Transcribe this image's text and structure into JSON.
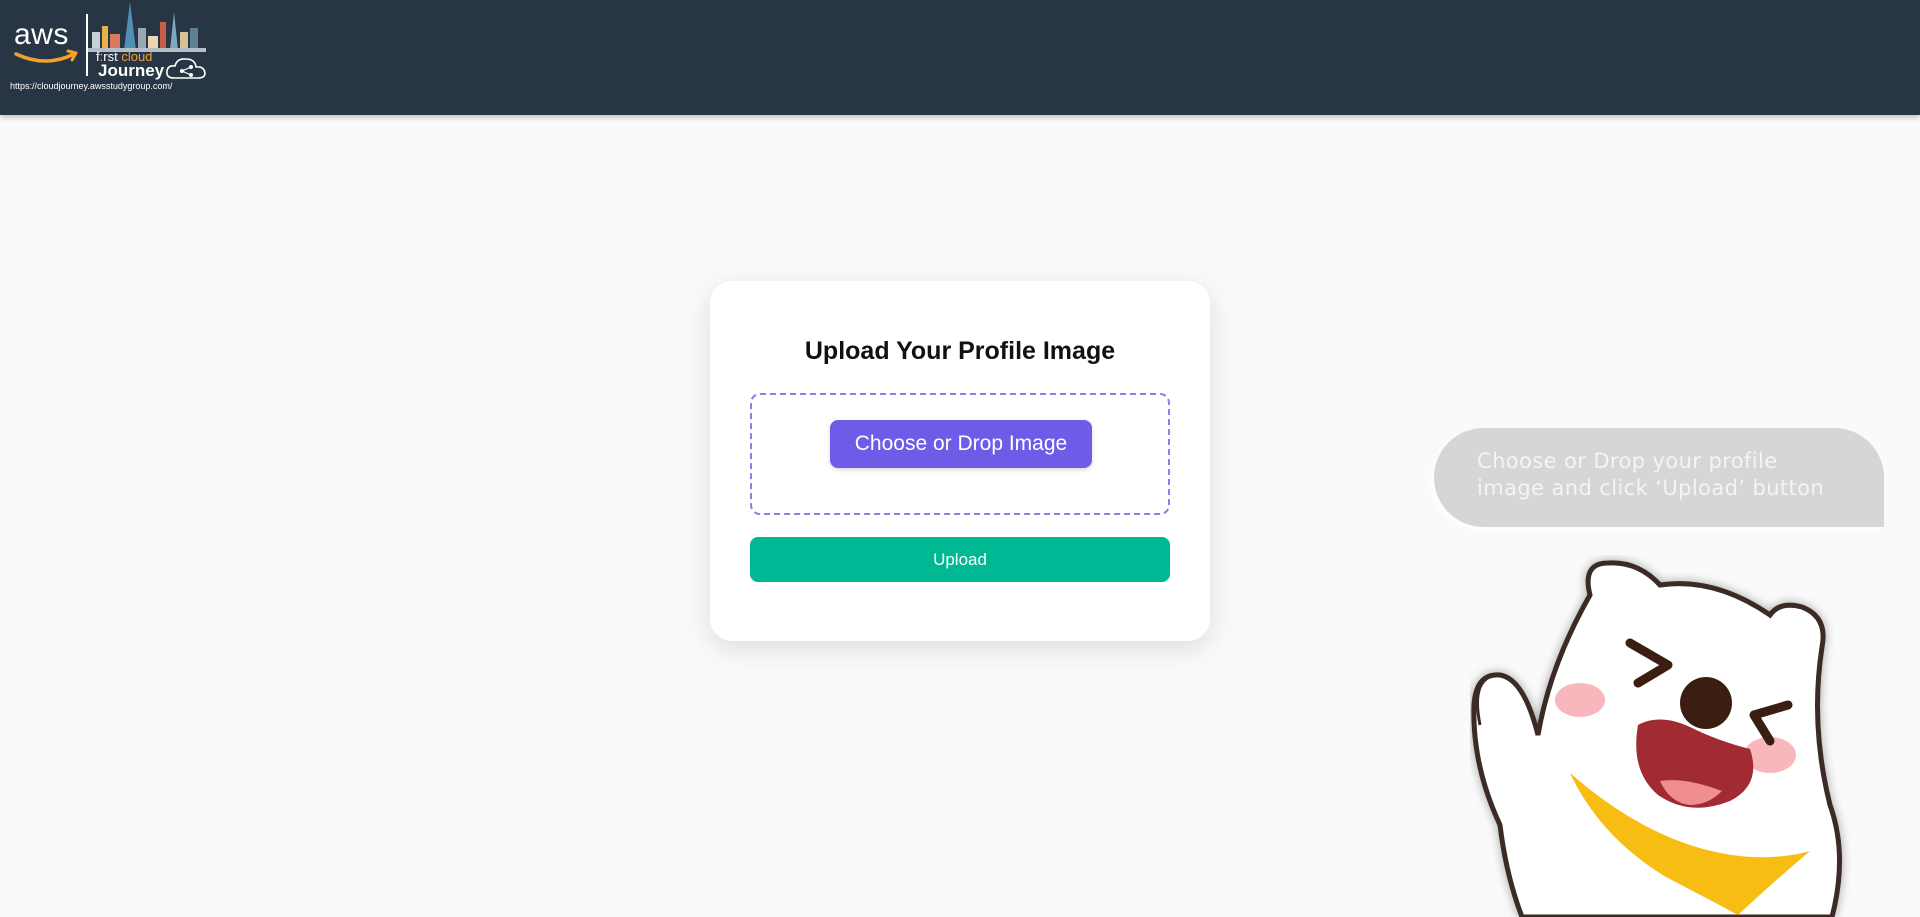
{
  "header": {
    "logo": {
      "brand": "aws",
      "first_prefix": "f",
      "first_rest": "rst",
      "first_cloud": "cloud",
      "journey": "Journey",
      "url": "https://cloudjourney.awsstudygroup.com/"
    }
  },
  "card": {
    "title": "Upload Your Profile Image",
    "choose_label": "Choose or Drop Image",
    "upload_label": "Upload"
  },
  "hint": {
    "line1": "Choose or Drop your profile",
    "line2": "image and click ‘Upload’ button"
  },
  "colors": {
    "header_bg": "#283544",
    "page_bg": "#fafafa",
    "choose_button": "#6c5ce7",
    "upload_button": "#00b894",
    "dropzone_border": "#8b7ee8",
    "bubble_bg": "#d6d6d6"
  },
  "icons": {
    "logo": "aws-first-cloud-journey-logo",
    "mascot": "waving-bear-mascot"
  }
}
